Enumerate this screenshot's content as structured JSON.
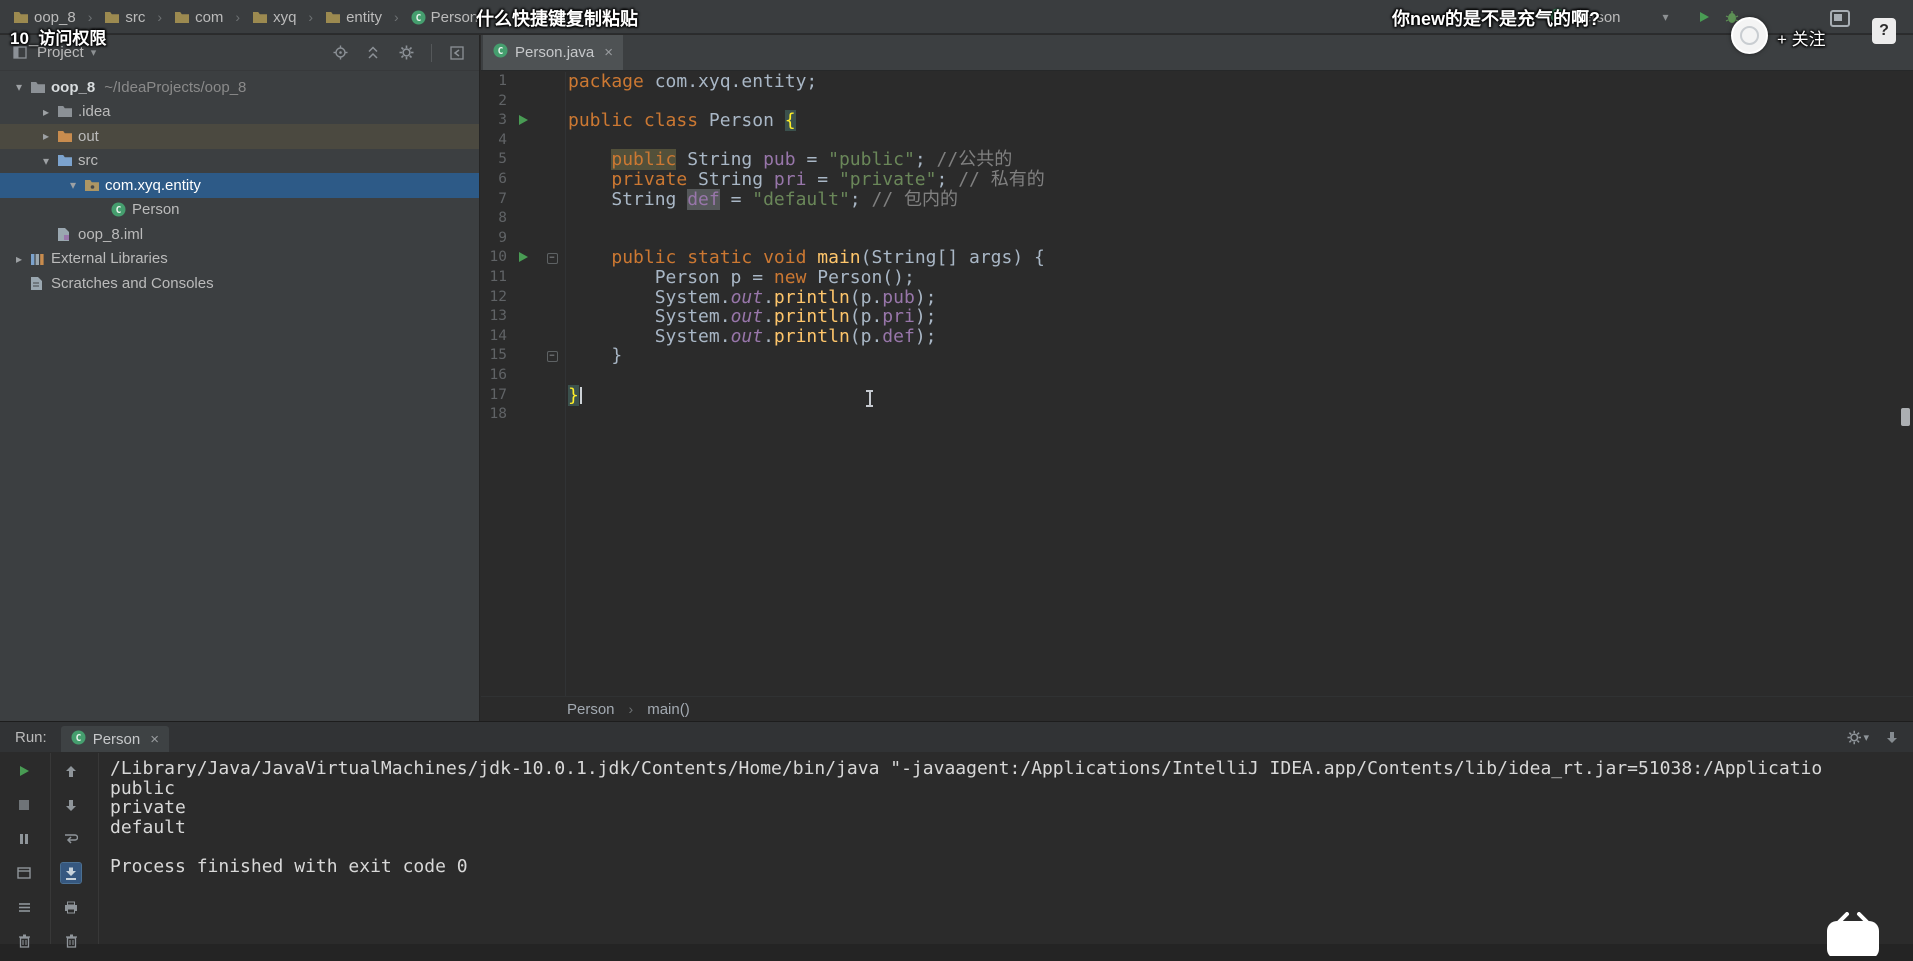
{
  "colors": {
    "selection_blue": "#2D5A87",
    "run_green": "#499C54",
    "keyword_orange": "#CC7832",
    "string_green": "#6A8759",
    "comment_gray": "#808080",
    "field_purple": "#9876AA",
    "method_yellow": "#FFC66B",
    "editor_bg": "#2B2B2B",
    "panel_bg": "#3C3F41"
  },
  "video_overlay": {
    "title": "10_访问权限",
    "danmaku": [
      "什么快捷键复制粘贴",
      "你new的是不是充气的啊?"
    ],
    "follow_button": "+ 关注",
    "help_button": "?"
  },
  "navbar": {
    "breadcrumbs": [
      {
        "label": "oop_8",
        "icon": "folder-icon"
      },
      {
        "label": "src",
        "icon": "folder-icon"
      },
      {
        "label": "com",
        "icon": "folder-icon"
      },
      {
        "label": "xyq",
        "icon": "folder-icon"
      },
      {
        "label": "entity",
        "icon": "folder-icon"
      },
      {
        "label": "Person",
        "icon": "class-icon"
      }
    ],
    "run_config": {
      "label": "Person"
    }
  },
  "project_panel": {
    "header": {
      "title": "Project",
      "icons": [
        "locate-icon",
        "collapse-all-icon",
        "settings-gear-icon",
        "divider",
        "hide-panel-icon"
      ]
    },
    "tree": [
      {
        "label": "oop_8",
        "hint": "~/IdeaProjects/oop_8",
        "level": 0,
        "arrow": "open",
        "icon": "folder-icon",
        "color": "#8C9196",
        "bold": true
      },
      {
        "label": ".idea",
        "level": 1,
        "arrow": "closed",
        "icon": "folder-icon",
        "color": "#8C9196"
      },
      {
        "label": "out",
        "level": 1,
        "arrow": "closed",
        "icon": "folder-icon",
        "color": "#C88C4E",
        "row": "hl"
      },
      {
        "label": "src",
        "level": 1,
        "arrow": "open",
        "icon": "folder-icon",
        "color": "#7CA3CE"
      },
      {
        "label": "com.xyq.entity",
        "level": 2,
        "arrow": "open",
        "icon": "package-icon",
        "color": "#AD9664",
        "row": "selected"
      },
      {
        "label": "Person",
        "level": 3,
        "arrow": "none",
        "icon": "class-icon"
      },
      {
        "label": "oop_8.iml",
        "level": 1,
        "arrow": "none",
        "icon": "module-file-icon",
        "color": "#9AA7B0"
      },
      {
        "label": "External Libraries",
        "level": 0,
        "arrow": "closed",
        "icon": "library-icon"
      },
      {
        "label": "Scratches and Consoles",
        "level": 0,
        "arrow": "none",
        "icon": "scratches-icon",
        "color": "#9AA7B0"
      }
    ]
  },
  "editor": {
    "tab": {
      "title": "Person.java",
      "icon": "class-icon"
    },
    "breadcrumbs": [
      "Person",
      "main()"
    ],
    "lines": [
      {
        "n": 1,
        "t": [
          [
            "k",
            "package"
          ],
          [
            "p",
            " com.xyq.entity;"
          ]
        ]
      },
      {
        "n": 2,
        "t": []
      },
      {
        "n": 3,
        "run": true,
        "t": [
          [
            "k",
            "public class"
          ],
          [
            "p",
            " Person "
          ],
          [
            "b",
            "{"
          ]
        ]
      },
      {
        "n": 4,
        "t": []
      },
      {
        "n": 5,
        "t": [
          [
            "p",
            "    "
          ],
          [
            "hk",
            "public"
          ],
          [
            "p",
            " String "
          ],
          [
            "f",
            "pub"
          ],
          [
            "p",
            " = "
          ],
          [
            "s",
            "\"public\""
          ],
          [
            "p",
            "; "
          ],
          [
            "c",
            "//公共的"
          ]
        ]
      },
      {
        "n": 6,
        "t": [
          [
            "p",
            "    "
          ],
          [
            "k",
            "private"
          ],
          [
            "p",
            " String "
          ],
          [
            "f",
            "pri"
          ],
          [
            "p",
            " = "
          ],
          [
            "s",
            "\"private\""
          ],
          [
            "p",
            "; "
          ],
          [
            "c",
            "// 私有的"
          ]
        ]
      },
      {
        "n": 7,
        "t": [
          [
            "p",
            "    String "
          ],
          [
            "hf",
            "def"
          ],
          [
            "p",
            " = "
          ],
          [
            "s",
            "\"default\""
          ],
          [
            "p",
            "; "
          ],
          [
            "c",
            "// 包内的"
          ]
        ]
      },
      {
        "n": 8,
        "t": []
      },
      {
        "n": 9,
        "t": []
      },
      {
        "n": 10,
        "run": true,
        "fold": true,
        "t": [
          [
            "p",
            "    "
          ],
          [
            "k",
            "public static void"
          ],
          [
            "p",
            " "
          ],
          [
            "m",
            "main"
          ],
          [
            "p",
            "(String[] args) {"
          ]
        ]
      },
      {
        "n": 11,
        "t": [
          [
            "p",
            "        Person p = "
          ],
          [
            "k",
            "new"
          ],
          [
            "p",
            " Person();"
          ]
        ]
      },
      {
        "n": 12,
        "t": [
          [
            "p",
            "        System."
          ],
          [
            "fi",
            "out"
          ],
          [
            "p",
            "."
          ],
          [
            "m",
            "println"
          ],
          [
            "p",
            "(p."
          ],
          [
            "f",
            "pub"
          ],
          [
            "p",
            ");"
          ]
        ]
      },
      {
        "n": 13,
        "t": [
          [
            "p",
            "        System."
          ],
          [
            "fi",
            "out"
          ],
          [
            "p",
            "."
          ],
          [
            "m",
            "println"
          ],
          [
            "p",
            "(p."
          ],
          [
            "f",
            "pri"
          ],
          [
            "p",
            ");"
          ]
        ]
      },
      {
        "n": 14,
        "t": [
          [
            "p",
            "        System."
          ],
          [
            "fi",
            "out"
          ],
          [
            "p",
            "."
          ],
          [
            "m",
            "println"
          ],
          [
            "p",
            "(p."
          ],
          [
            "f",
            "def"
          ],
          [
            "p",
            ");"
          ]
        ]
      },
      {
        "n": 15,
        "fold": true,
        "t": [
          [
            "p",
            "    }"
          ]
        ]
      },
      {
        "n": 16,
        "t": []
      },
      {
        "n": 17,
        "t": [
          [
            "b",
            "}"
          ],
          [
            "caret",
            ""
          ]
        ]
      },
      {
        "n": 18,
        "t": []
      }
    ]
  },
  "run_panel": {
    "label": "Run:",
    "tab": {
      "title": "Person",
      "icon": "class-icon"
    },
    "toolbar_left": [
      "rerun-icon",
      "stop-icon",
      "pause-output-icon",
      "frame-icon",
      "settings-list-icon",
      "trash-icon"
    ],
    "toolbar_inner": [
      "arrow-up-icon",
      "arrow-down-icon",
      "softwrap-icon",
      "scroll-end-icon",
      "print-icon",
      "clear-icon"
    ],
    "toolbar_inner_active": "scroll-end-icon",
    "console": [
      "/Library/Java/JavaVirtualMachines/jdk-10.0.1.jdk/Contents/Home/bin/java \"-javaagent:/Applications/IntelliJ IDEA.app/Contents/lib/idea_rt.jar=51038:/Applicatio",
      "public",
      "private",
      "default",
      "",
      "Process finished with exit code 0"
    ]
  }
}
